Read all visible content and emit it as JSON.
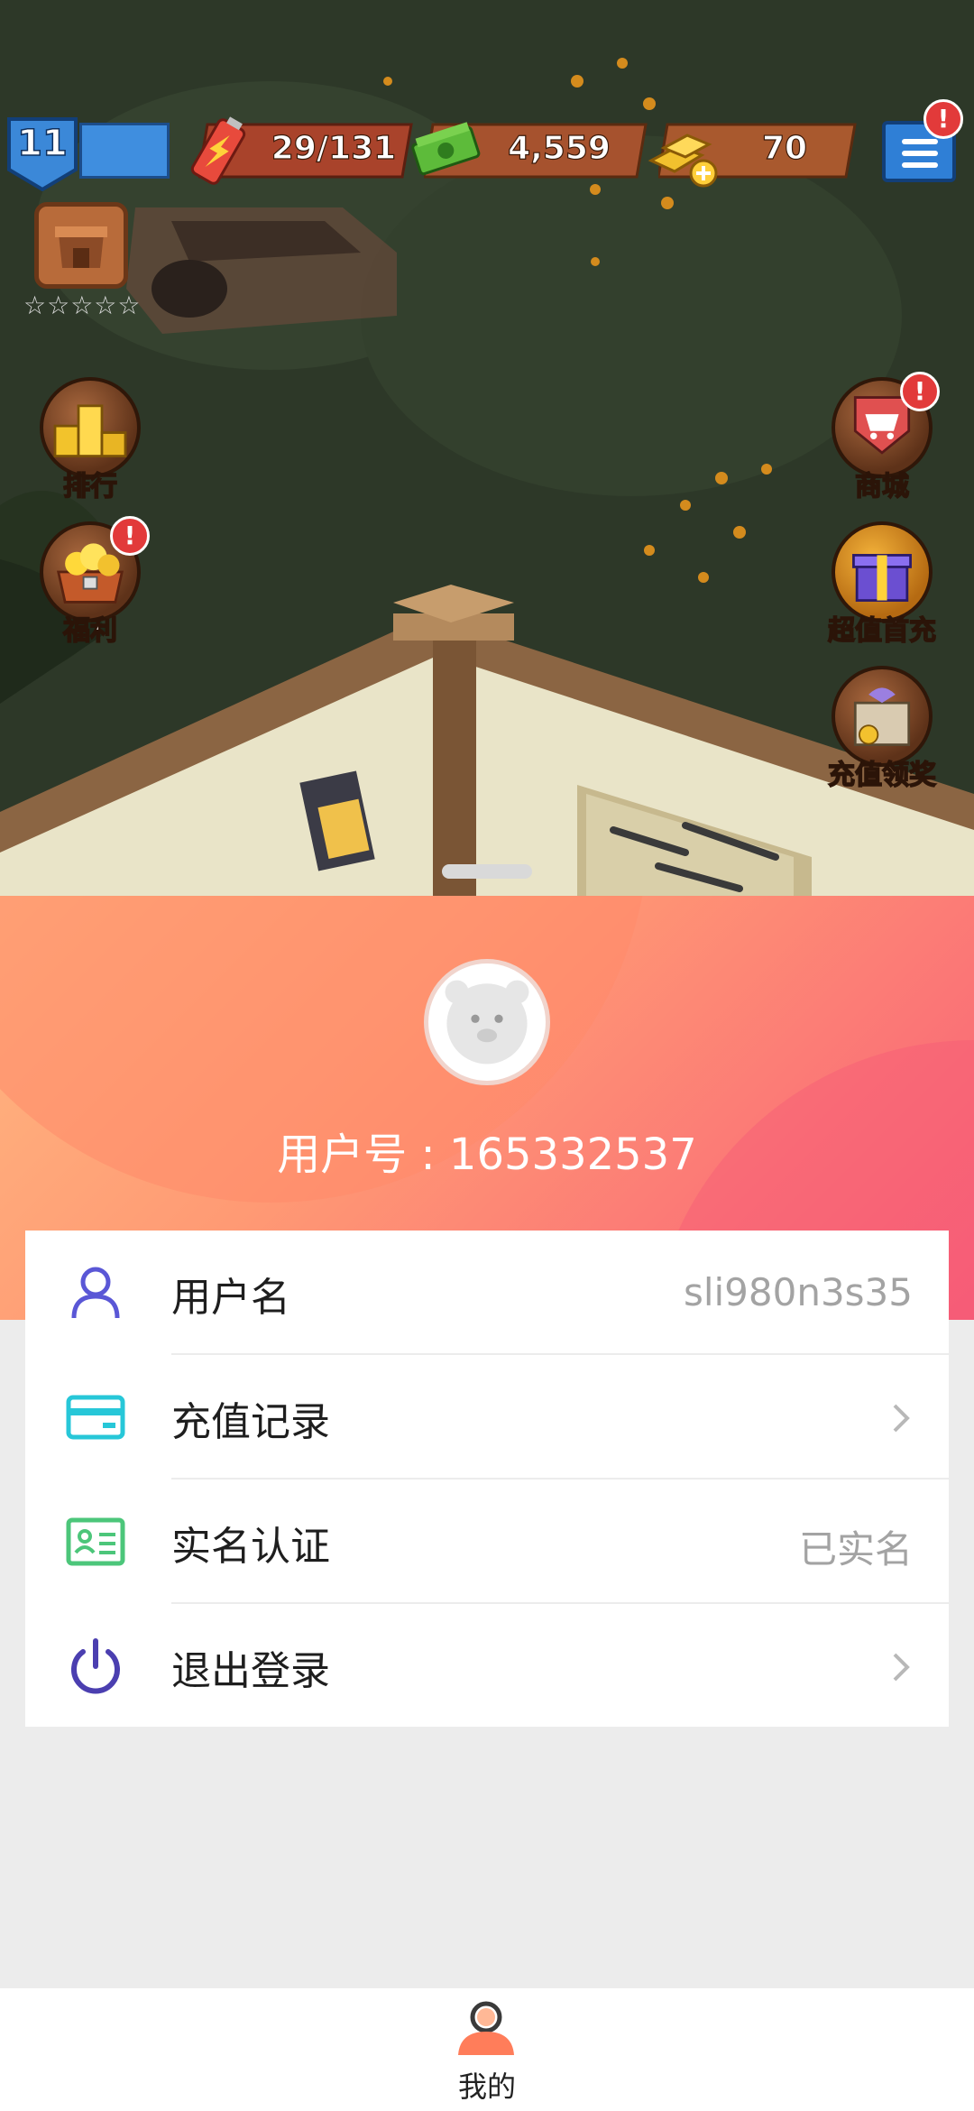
{
  "hud": {
    "level": "11",
    "energy": "29/131",
    "cash": "4,559",
    "gold": "70",
    "alert_mark": "!"
  },
  "game_buttons": {
    "ranking": "排行",
    "welfare": "福利",
    "shop": "商城",
    "first_recharge": "超值首充",
    "recharge_reward": "充值领奖",
    "stars": "☆☆☆☆☆"
  },
  "profile": {
    "user_id_text": "用户号 : 165332537"
  },
  "menu": [
    {
      "label": "用户名",
      "value": "sli980n3s35",
      "icon": "user-icon"
    },
    {
      "label": "充值记录",
      "value": "",
      "icon": "card-icon"
    },
    {
      "label": "实名认证",
      "value": "已实名",
      "icon": "id-card-icon"
    },
    {
      "label": "退出登录",
      "value": "",
      "icon": "power-icon"
    }
  ],
  "bottom_nav": {
    "label": "我的"
  },
  "colors": {
    "accent_purple": "#5a57d6",
    "accent_cyan": "#27c7d8",
    "accent_green": "#4cc67a",
    "gradient_start": "#ffb780",
    "gradient_end": "#f65c77"
  }
}
